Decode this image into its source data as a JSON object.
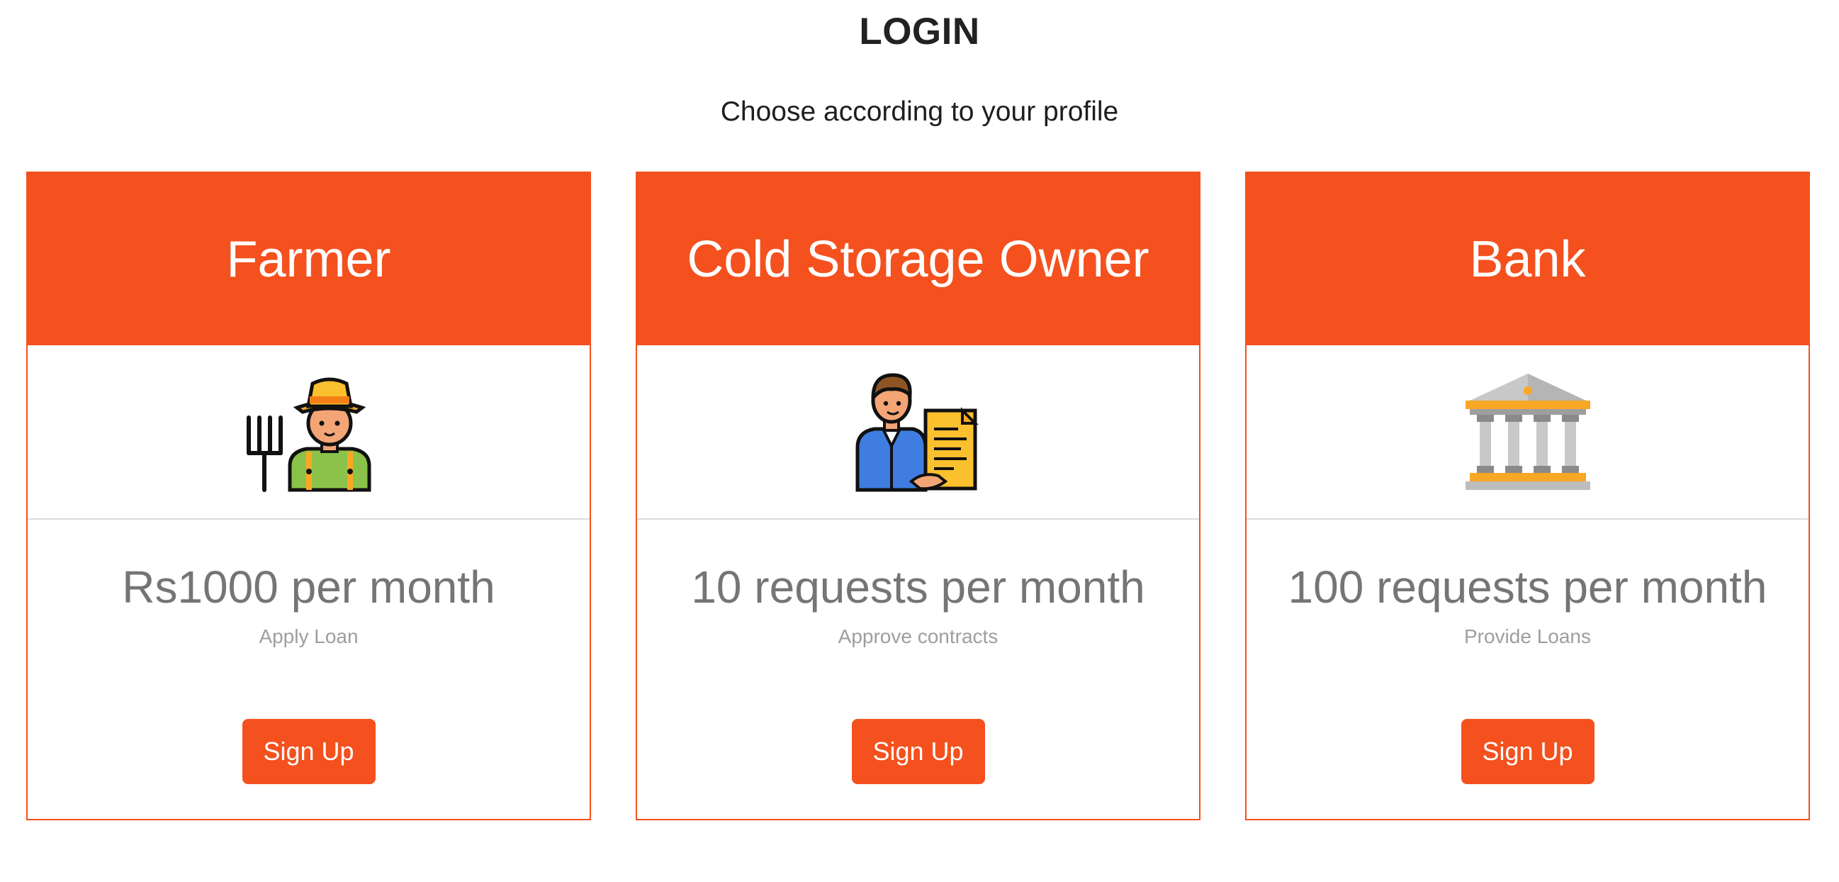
{
  "header": {
    "title": "LOGIN",
    "subtitle": "Choose according to your profile"
  },
  "colors": {
    "accent": "#f4511e",
    "price_text": "#757575",
    "description_text": "#9e9e9e"
  },
  "cards": [
    {
      "title": "Farmer",
      "icon": "farmer-icon",
      "price": "Rs1000 per month",
      "description": "Apply Loan",
      "button_label": "Sign Up"
    },
    {
      "title": "Cold Storage Owner",
      "icon": "business-person-document-icon",
      "price": "10 requests per month",
      "description": "Approve contracts",
      "button_label": "Sign Up"
    },
    {
      "title": "Bank",
      "icon": "bank-building-icon",
      "price": "100 requests per month",
      "description": "Provide Loans",
      "button_label": "Sign Up"
    }
  ]
}
